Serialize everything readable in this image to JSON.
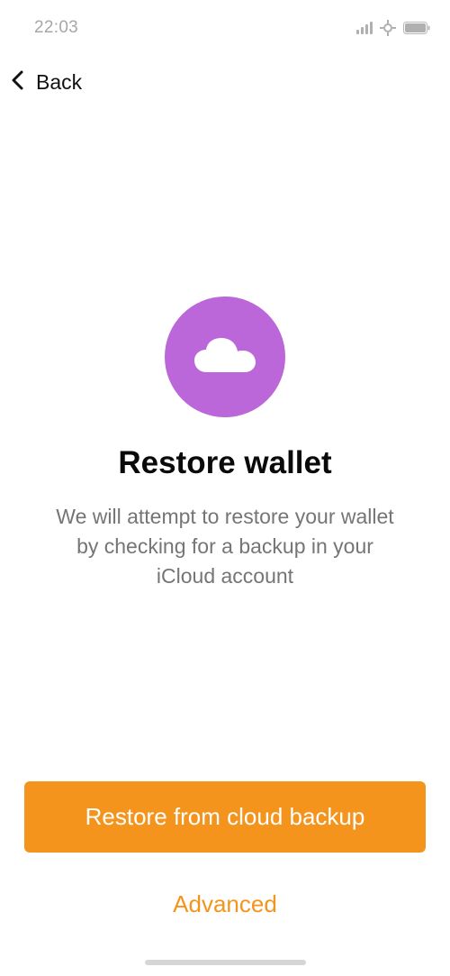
{
  "status_bar": {
    "time": "22:03",
    "icons": [
      "signal-icon",
      "wifi-icon",
      "battery-icon"
    ]
  },
  "nav": {
    "back_label": "Back",
    "back_icon": "chevron-left-icon"
  },
  "hero": {
    "icon": "cloud-icon",
    "badge_color": "#bc67d9",
    "title": "Restore wallet",
    "description": "We will attempt to restore your wallet\nby checking  for a backup in your\niCloud account"
  },
  "actions": {
    "primary_label": "Restore from cloud backup",
    "secondary_label": "Advanced",
    "accent_color": "#f5941d"
  }
}
